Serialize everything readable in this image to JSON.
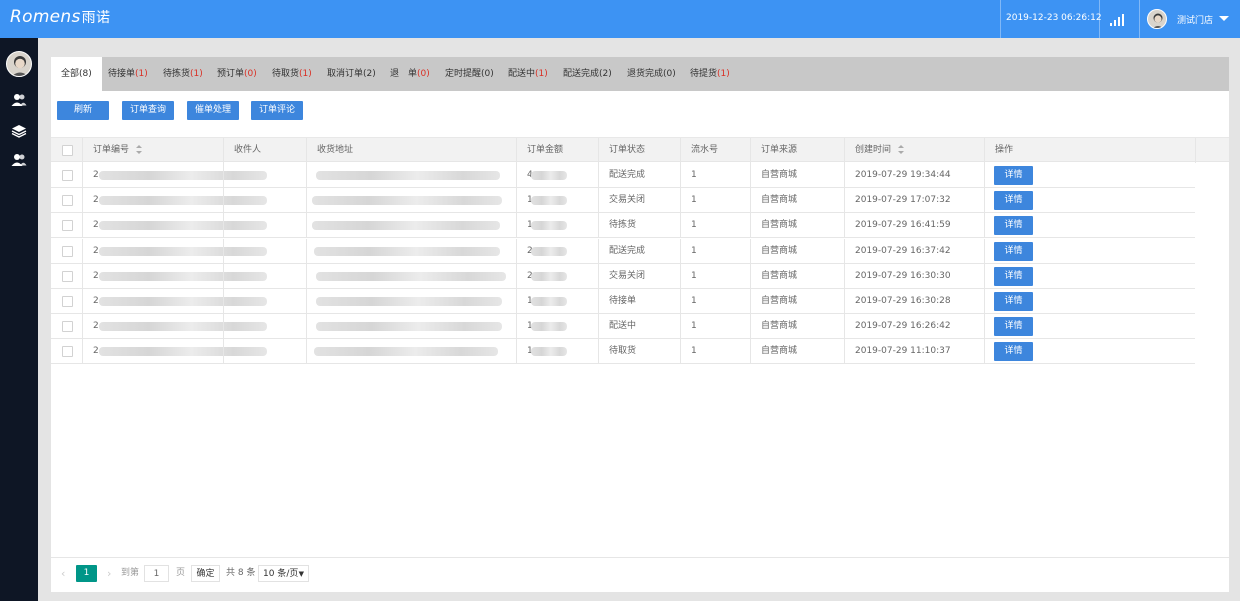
{
  "header": {
    "logo": "Romens",
    "logo_cn": "雨诺",
    "datetime": "2019-12-23 06:26:12",
    "username": "测试门店"
  },
  "tabs": [
    {
      "label": "全部",
      "count": "(8)"
    },
    {
      "label": "待接单",
      "count": "(1)"
    },
    {
      "label": "待拣货",
      "count": "(1)"
    },
    {
      "label": "预订单",
      "count": "(0)"
    },
    {
      "label": "待取货",
      "count": "(1)"
    },
    {
      "label": "取消订单",
      "count": "(2)"
    },
    {
      "label": "退　单",
      "count": "(0)"
    },
    {
      "label": "定时提醒",
      "count": "(0)"
    },
    {
      "label": "配送中",
      "count": "(1)"
    },
    {
      "label": "配送完成",
      "count": "(2)"
    },
    {
      "label": "退货完成",
      "count": "(0)"
    },
    {
      "label": "待提货",
      "count": "(1)"
    }
  ],
  "toolbar": {
    "refresh": "刷新",
    "order_query": "订单查询",
    "urge": "催单处理",
    "review": "订单评论"
  },
  "table": {
    "columns": [
      "订单编号",
      "收件人",
      "收货地址",
      "订单金额",
      "订单状态",
      "流水号",
      "订单来源",
      "创建时间",
      "操作"
    ],
    "detail_label": "详情",
    "rows": [
      {
        "id_prefix": "2",
        "amount_prefix": "4",
        "status": "配送完成",
        "serial": "1",
        "source": "自营商城",
        "created": "2019-07-29 19:34:44"
      },
      {
        "id_prefix": "2",
        "amount_prefix": "1",
        "status": "交易关闭",
        "serial": "1",
        "source": "自营商城",
        "created": "2019-07-29 17:07:32"
      },
      {
        "id_prefix": "2",
        "amount_prefix": "1",
        "status": "待拣货",
        "serial": "1",
        "source": "自营商城",
        "created": "2019-07-29 16:41:59"
      },
      {
        "id_prefix": "2",
        "amount_prefix": "2",
        "status": "配送完成",
        "serial": "1",
        "source": "自营商城",
        "created": "2019-07-29 16:37:42"
      },
      {
        "id_prefix": "2",
        "amount_prefix": "2",
        "status": "交易关闭",
        "serial": "1",
        "source": "自营商城",
        "created": "2019-07-29 16:30:30"
      },
      {
        "id_prefix": "2",
        "amount_prefix": "1",
        "status": "待接单",
        "serial": "1",
        "source": "自营商城",
        "created": "2019-07-29 16:30:28"
      },
      {
        "id_prefix": "2",
        "amount_prefix": "1",
        "status": "配送中",
        "serial": "1",
        "source": "自营商城",
        "created": "2019-07-29 16:26:42"
      },
      {
        "id_prefix": "2",
        "amount_prefix": "1",
        "status": "待取货",
        "serial": "1",
        "source": "自营商城",
        "created": "2019-07-29 11:10:37"
      }
    ]
  },
  "pagination": {
    "current": "1",
    "goto_label": "到第",
    "goto_value": "1",
    "page_label": "页",
    "confirm": "确定",
    "total": "共 8 条",
    "page_size": "10 条/页"
  },
  "icons": [
    "user-group-icon",
    "layers-icon",
    "user-group-icon",
    "signal-icon",
    "chevron-down-icon"
  ]
}
